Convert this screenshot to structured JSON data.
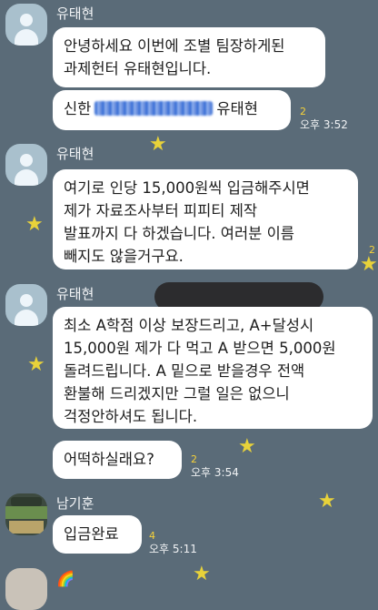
{
  "chat": {
    "messages": [
      {
        "sender": "유태현",
        "lines": [
          "안녕하세요 이번에 조별 팀장하게된",
          "과제헌터 유태현입니다."
        ]
      },
      {
        "lines_prefix": "신한",
        "lines_suffix": "유태현",
        "unread": "2",
        "time": "오후 3:52"
      },
      {
        "sender": "유태현",
        "lines": [
          "여기로 인당 15,000원씩 입금해주시면",
          "제가 자료조사부터 피피티 제작",
          "발표까지 다 하겠습니다. 여러분 이름",
          "빼지도 않을거구요."
        ],
        "unread": "2"
      },
      {
        "sender": "유태현",
        "lines": [
          "최소 A학점 이상 보장드리고, A+달성시",
          "15,000원 제가 다 먹고 A 받으면 5,000원",
          "돌려드립니다. A 밑으로 받을경우 전액",
          "환불해 드리겠지만 그럴 일은 없으니",
          "걱정안하셔도 됩니다."
        ]
      },
      {
        "lines": [
          "어떡하실래요?"
        ],
        "unread": "2",
        "time": "오후 3:54"
      },
      {
        "sender": "남기훈",
        "lines": [
          "입금완료"
        ],
        "unread": "4",
        "time": "오후 5:11"
      }
    ]
  },
  "colors": {
    "background": "#5a6b78",
    "bubble": "#ffffff",
    "unread": "#f6d23a"
  },
  "icons": [
    "default-avatar-icon",
    "photo-avatar-icon",
    "star-icon",
    "rainbow-icon"
  ]
}
